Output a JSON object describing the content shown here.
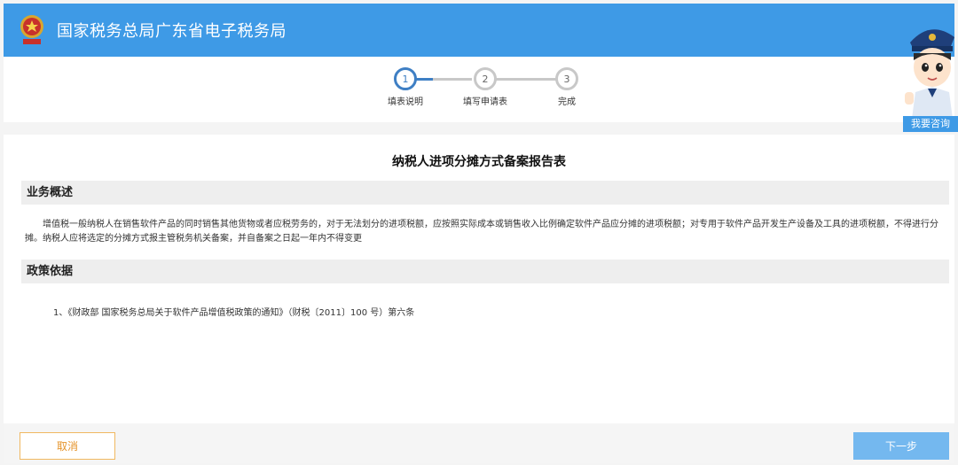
{
  "header": {
    "title": "国家税务总局广东省电子税务局",
    "emblem_icon": "tax-emblem-icon"
  },
  "steps": [
    {
      "number": "1",
      "label": "填表说明",
      "active": true
    },
    {
      "number": "2",
      "label": "填写申请表",
      "active": false
    },
    {
      "number": "3",
      "label": "完成",
      "active": false
    }
  ],
  "consult": {
    "label": "我要咨询"
  },
  "document": {
    "title": "纳税人进项分摊方式备案报告表",
    "overview": {
      "heading": "业务概述",
      "text": "增值税一般纳税人在销售软件产品的同时销售其他货物或者应税劳务的，对于无法划分的进项税额，应按照实际成本或销售收入比例确定软件产品应分摊的进项税额；对专用于软件产品开发生产设备及工具的进项税额，不得进行分摊。纳税人应将选定的分摊方式报主管税务机关备案，并自备案之日起一年内不得变更"
    },
    "policy": {
      "heading": "政策依据",
      "items": [
        "1、《财政部 国家税务总局关于软件产品增值税政策的通知》（财税〔2011〕100 号）第六条"
      ]
    }
  },
  "footer": {
    "cancel_label": "取消",
    "next_label": "下一步"
  },
  "colors": {
    "header": "#3e9ae6",
    "step_active": "#3e7fc4",
    "cancel": "#e5932a",
    "next": "#74b8ef"
  }
}
